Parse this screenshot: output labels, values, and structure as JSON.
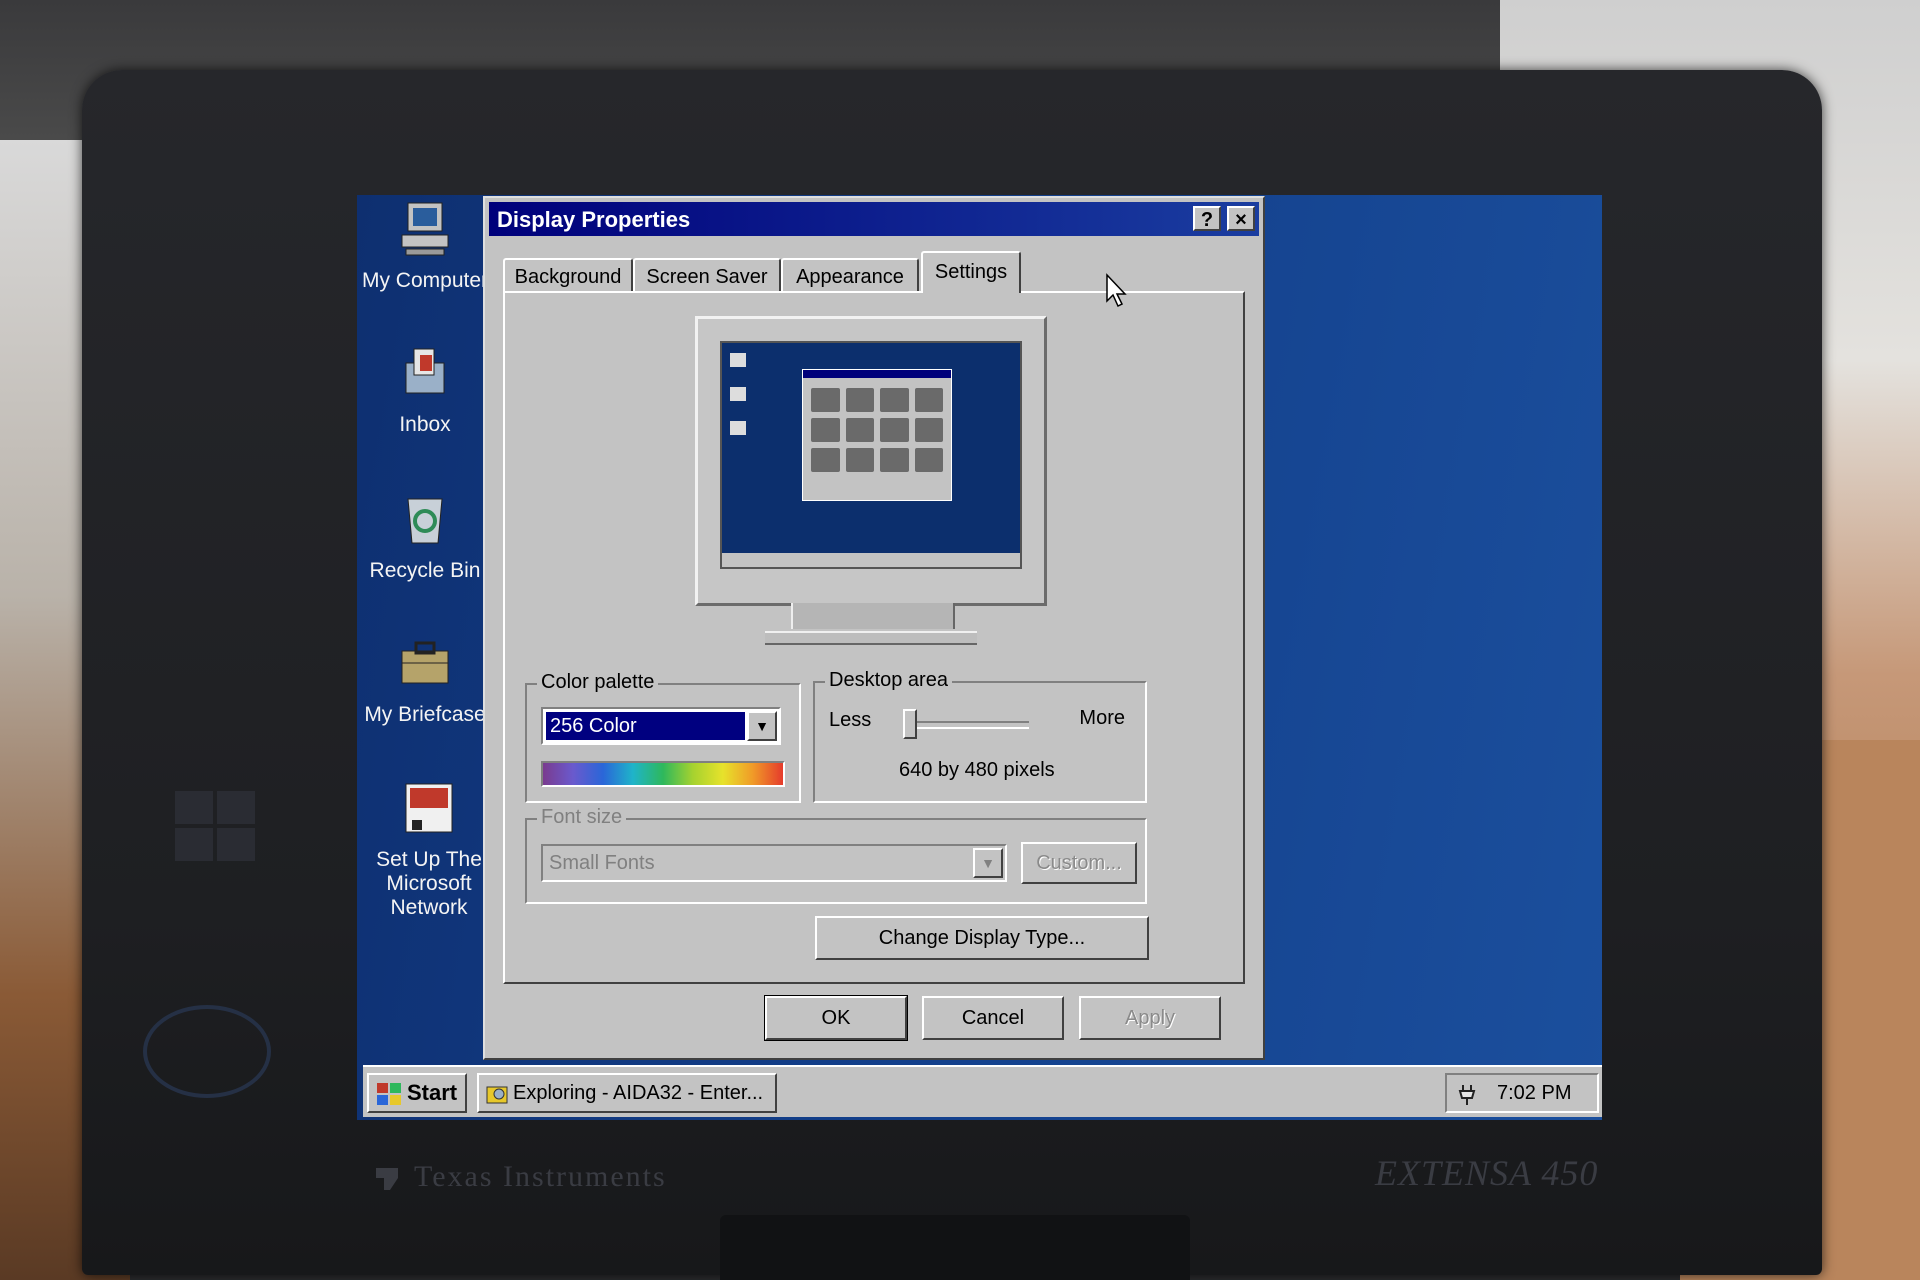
{
  "desktop": {
    "icons": [
      {
        "name": "My Computer",
        "icon": "computer-icon"
      },
      {
        "name": "Inbox",
        "icon": "inbox-icon"
      },
      {
        "name": "Recycle Bin",
        "icon": "recycle-bin-icon"
      },
      {
        "name": "My Briefcase",
        "icon": "briefcase-icon"
      },
      {
        "name": "Set Up The Microsoft Network",
        "icon": "msn-icon"
      }
    ]
  },
  "dialog": {
    "title": "Display Properties",
    "help_label": "?",
    "close_label": "×",
    "tabs": [
      {
        "label": "Background"
      },
      {
        "label": "Screen Saver"
      },
      {
        "label": "Appearance"
      },
      {
        "label": "Settings",
        "active": true
      }
    ],
    "color_palette": {
      "label": "Color palette",
      "value": "256 Color"
    },
    "desktop_area": {
      "label": "Desktop area",
      "less": "Less",
      "more": "More",
      "resolution": "640 by 480 pixels",
      "slider_fraction": 0.0
    },
    "font_size": {
      "label": "Font size",
      "value": "Small Fonts",
      "custom_label": "Custom..."
    },
    "change_display_label": "Change Display Type...",
    "ok_label": "OK",
    "cancel_label": "Cancel",
    "apply_label": "Apply"
  },
  "taskbar": {
    "start_label": "Start",
    "task_label": "Exploring - AIDA32 - Enter...",
    "clock": "7:02 PM"
  },
  "hardware": {
    "brand": "Texas Instruments",
    "model_prefix": "EXTENSA",
    "model_number": "450"
  },
  "colors": {
    "desktop_blue": "#13408c",
    "title_bar": "#00007b",
    "dialog_face": "#c3c3c3"
  }
}
